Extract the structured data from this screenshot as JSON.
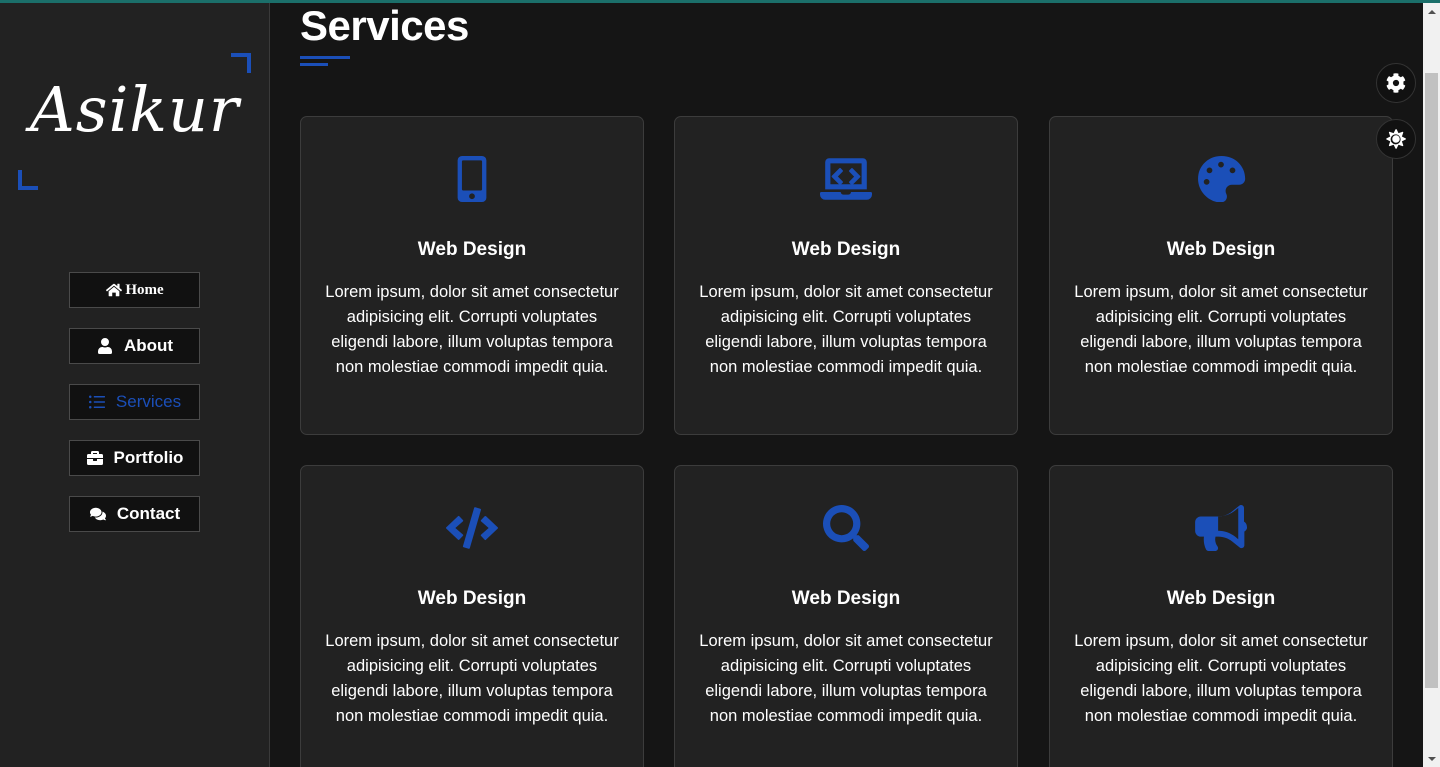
{
  "colors": {
    "accent": "#1b4fb8",
    "background": "#151515",
    "card": "#222222",
    "sidebar": "#222222"
  },
  "logo": {
    "text": "Asikur"
  },
  "nav": {
    "items": [
      {
        "label": "Home",
        "icon": "home-icon"
      },
      {
        "label": "About",
        "icon": "user-icon"
      },
      {
        "label": "Services",
        "icon": "list-icon",
        "active": true
      },
      {
        "label": "Portfolio",
        "icon": "briefcase-icon"
      },
      {
        "label": "Contact",
        "icon": "comments-icon"
      }
    ]
  },
  "page": {
    "title": "Services"
  },
  "services": [
    {
      "icon": "mobile-icon",
      "title": "Web Design",
      "text": "Lorem ipsum, dolor sit amet consectetur adipisicing elit. Corrupti voluptates eligendi labore, illum voluptas tempora non molestiae commodi impedit quia."
    },
    {
      "icon": "laptop-code-icon",
      "title": "Web Design",
      "text": "Lorem ipsum, dolor sit amet consectetur adipisicing elit. Corrupti voluptates eligendi labore, illum voluptas tempora non molestiae commodi impedit quia."
    },
    {
      "icon": "palette-icon",
      "title": "Web Design",
      "text": "Lorem ipsum, dolor sit amet consectetur adipisicing elit. Corrupti voluptates eligendi labore, illum voluptas tempora non molestiae commodi impedit quia."
    },
    {
      "icon": "code-icon",
      "title": "Web Design",
      "text": "Lorem ipsum, dolor sit amet consectetur adipisicing elit. Corrupti voluptates eligendi labore, illum voluptas tempora non molestiae commodi impedit quia."
    },
    {
      "icon": "search-icon",
      "title": "Web Design",
      "text": "Lorem ipsum, dolor sit amet consectetur adipisicing elit. Corrupti voluptates eligendi labore, illum voluptas tempora non molestiae commodi impedit quia."
    },
    {
      "icon": "bullhorn-icon",
      "title": "Web Design",
      "text": "Lorem ipsum, dolor sit amet consectetur adipisicing elit. Corrupti voluptates eligendi labore, illum voluptas tempora non molestiae commodi impedit quia."
    }
  ],
  "controls": {
    "settings_icon": "gear-icon",
    "theme_icon": "sun-icon"
  }
}
